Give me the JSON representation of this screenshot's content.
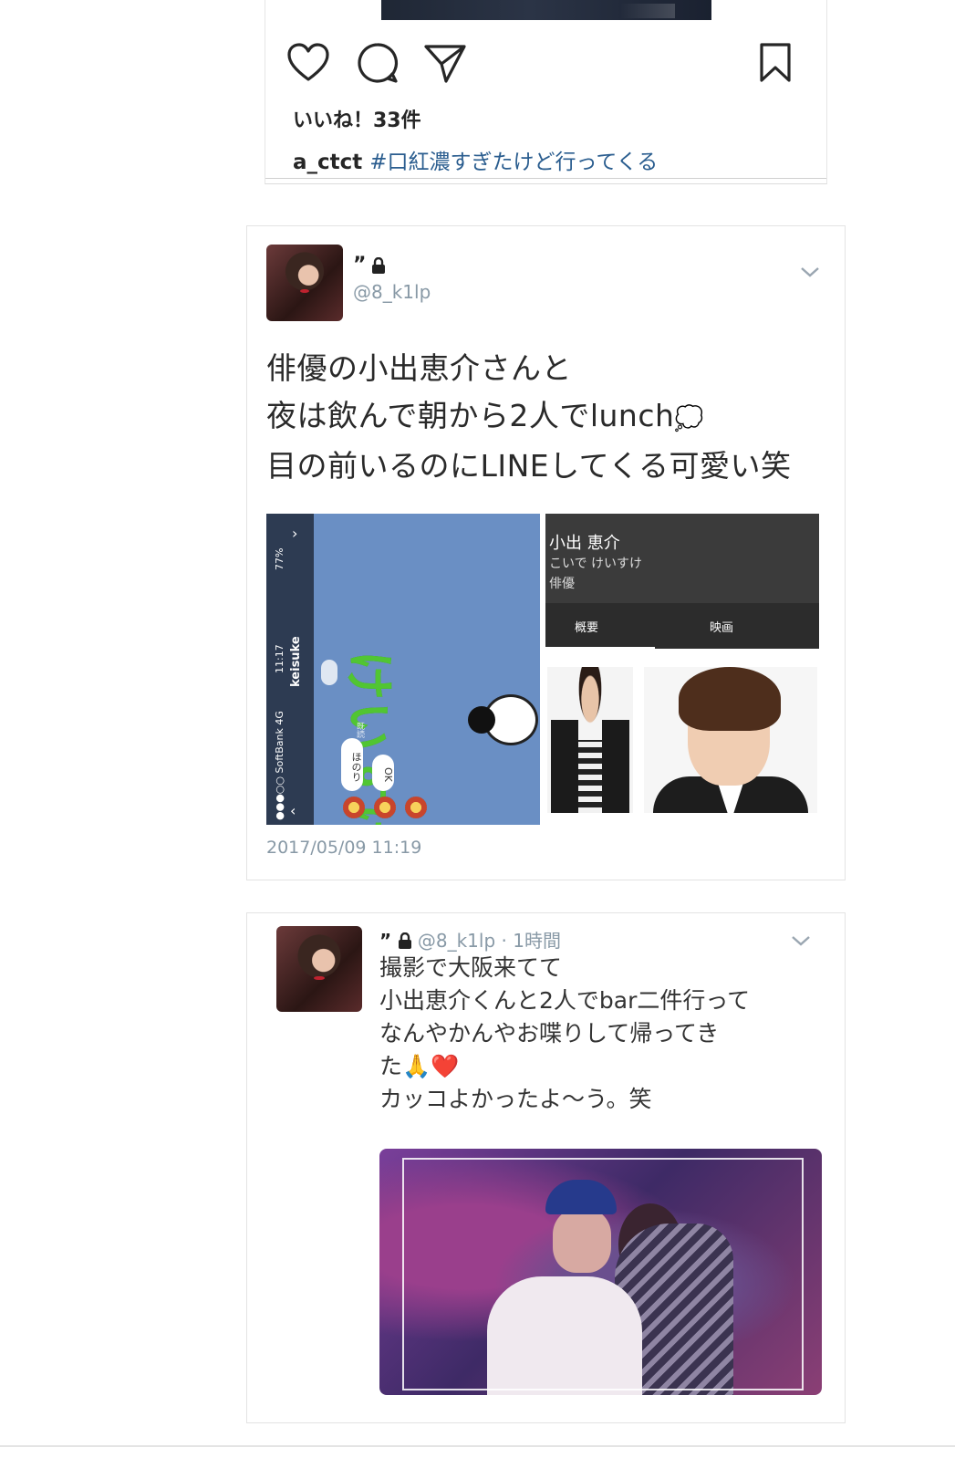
{
  "instagram": {
    "likes_text": "いいね！33件",
    "caption_user": "a_ctct",
    "caption_hashtag": "#口紅濃すぎたけど行ってくる",
    "icons": [
      "heart-icon",
      "comment-icon",
      "share-icon",
      "bookmark-icon"
    ]
  },
  "tweet1": {
    "display_name_mark": "”",
    "handle": "@8_k1lp",
    "text_line1": "俳優の小出恵介さんと",
    "text_line2": "夜は飲んで朝から2人でlunch",
    "text_line3": "目の前いるのにLINEしてくる可愛い笑",
    "speech_glyph": "💭",
    "timestamp": "2017/05/09 11:19",
    "line_screenshot": {
      "carrier": "●●●○○ SoftBank 4G",
      "time": "11:17",
      "battery": "77%",
      "chat_name": "keisuke",
      "sticker_text": "けいすけ",
      "bubble1": "ほのり",
      "bubble2": "OK",
      "bubble3": "既読"
    },
    "profile_screenshot": {
      "name": "小出 恵介",
      "reading": "こいで けいすけ",
      "occupation": "俳優",
      "tab1": "概要",
      "tab2": "映画"
    }
  },
  "tweet2": {
    "display_name_mark": "”",
    "handle": "@8_k1lp",
    "time_ago": "1時間",
    "text_line1": "撮影で大阪来てて",
    "text_line2": "小出恵介くんと2人でbar二件行って",
    "text_line3": "なんやかんやお喋りして帰ってき",
    "text_line4": "た🙏❤️",
    "text_line5": "カッコよかったよ〜う。笑"
  },
  "colors": {
    "link_blue": "#2a5d8f",
    "meta_gray": "#8899a6",
    "line_green": "#51c533"
  }
}
